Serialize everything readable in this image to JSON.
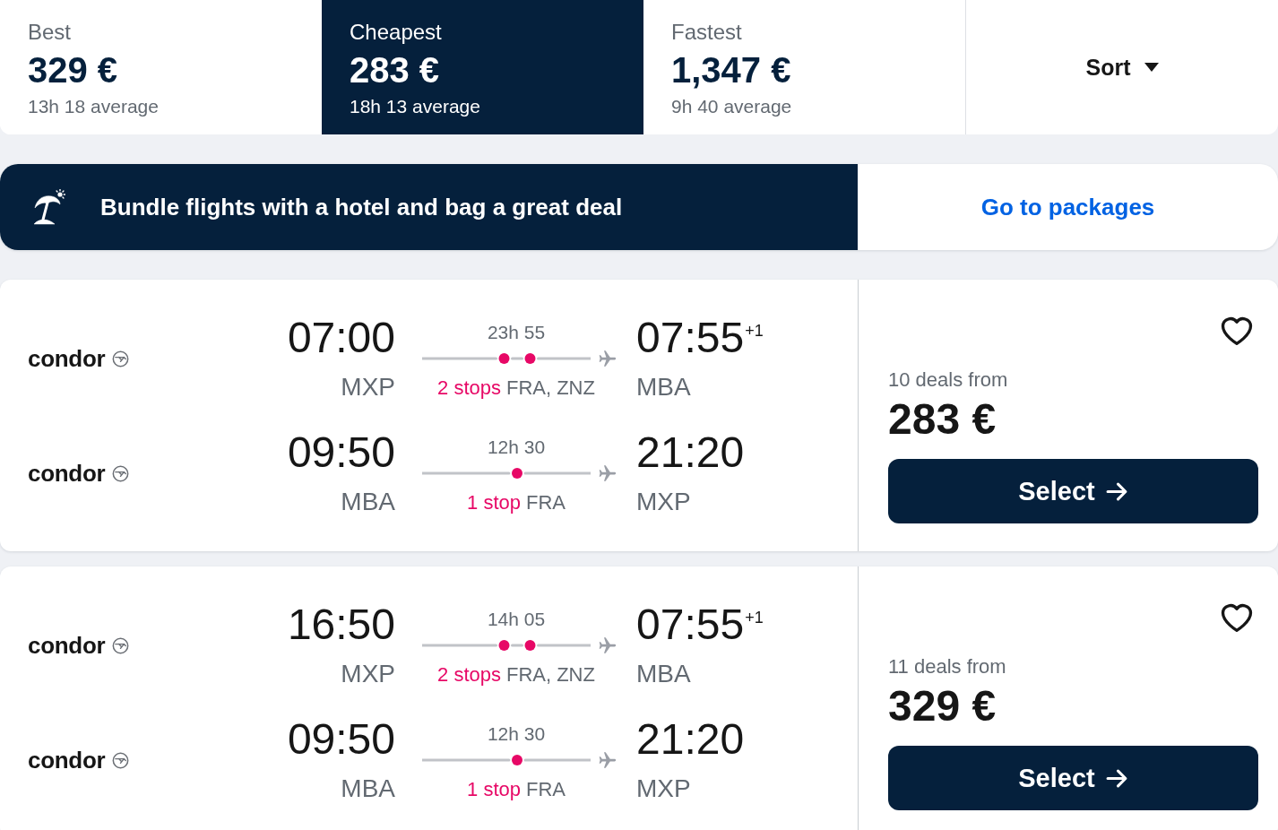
{
  "tabs": [
    {
      "label": "Best",
      "price": "329 €",
      "average": "13h 18 average",
      "selected": false
    },
    {
      "label": "Cheapest",
      "price": "283 €",
      "average": "18h 13 average",
      "selected": true
    },
    {
      "label": "Fastest",
      "price": "1,347 €",
      "average": "9h 40 average",
      "selected": false
    }
  ],
  "sort": {
    "label": "Sort"
  },
  "banner": {
    "text": "Bundle flights with a hotel and bag a great deal",
    "link": "Go to packages"
  },
  "results": [
    {
      "legs": [
        {
          "airline": "condor",
          "depart_time": "07:00",
          "depart_airport": "MXP",
          "duration": "23h 55",
          "stops_label": "2 stops",
          "stops": [
            {
              "airport": "FRA,"
            },
            {
              "airport": "ZNZ"
            }
          ],
          "arrive_time": "07:55",
          "day_offset": "+1",
          "arrive_airport": "MBA"
        },
        {
          "airline": "condor",
          "depart_time": "09:50",
          "depart_airport": "MBA",
          "duration": "12h 30",
          "stops_label": "1 stop",
          "stops": [
            {
              "airport": "FRA"
            }
          ],
          "arrive_time": "21:20",
          "arrive_airport": "MXP"
        }
      ],
      "deals": "10 deals from",
      "price": "283 €",
      "button": "Select",
      "saved": false
    },
    {
      "legs": [
        {
          "airline": "condor",
          "depart_time": "16:50",
          "depart_airport": "MXP",
          "duration": "14h 05",
          "stops_label": "2 stops",
          "stops": [
            {
              "airport": "FRA,"
            },
            {
              "airport": "ZNZ"
            }
          ],
          "arrive_time": "07:55",
          "day_offset": "+1",
          "arrive_airport": "MBA"
        },
        {
          "airline": "condor",
          "depart_time": "09:50",
          "depart_airport": "MBA",
          "duration": "12h 30",
          "stops_label": "1 stop",
          "stops": [
            {
              "airport": "FRA"
            }
          ],
          "arrive_time": "21:20",
          "arrive_airport": "MXP"
        }
      ],
      "deals": "11 deals from",
      "price": "329 €",
      "button": "Select",
      "saved": false
    }
  ]
}
